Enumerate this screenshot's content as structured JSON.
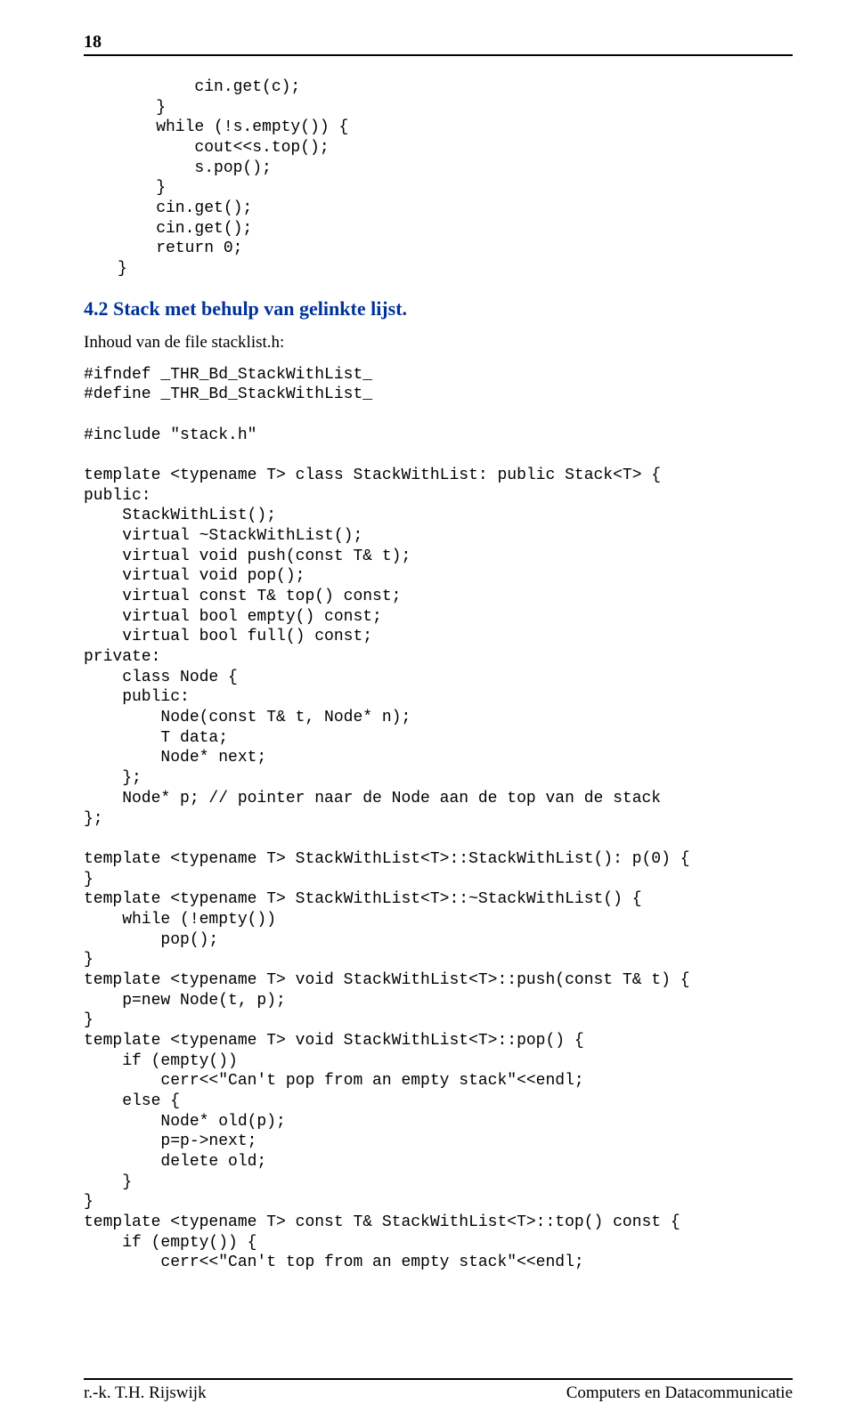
{
  "page_number": "18",
  "code_block_top": "        cin.get(c);\n    }\n    while (!s.empty()) {\n        cout<<s.top();\n        s.pop();\n    }\n    cin.get();\n    cin.get();\n    return 0;\n}",
  "section_heading": "4.2  Stack met behulp van gelinkte lijst.",
  "file_label": "Inhoud van de file stacklist.h:",
  "code_block_main": "#ifndef _THR_Bd_StackWithList_\n#define _THR_Bd_StackWithList_\n\n#include \"stack.h\"\n\ntemplate <typename T> class StackWithList: public Stack<T> {\npublic:\n    StackWithList();\n    virtual ~StackWithList();\n    virtual void push(const T& t);\n    virtual void pop();\n    virtual const T& top() const;\n    virtual bool empty() const;\n    virtual bool full() const;\nprivate:\n    class Node {\n    public:\n        Node(const T& t, Node* n);\n        T data;\n        Node* next;\n    };\n    Node* p; // pointer naar de Node aan de top van de stack\n};\n\ntemplate <typename T> StackWithList<T>::StackWithList(): p(0) {\n}\ntemplate <typename T> StackWithList<T>::~StackWithList() {\n    while (!empty())\n        pop();\n}\ntemplate <typename T> void StackWithList<T>::push(const T& t) {\n    p=new Node(t, p);\n}\ntemplate <typename T> void StackWithList<T>::pop() {\n    if (empty())\n        cerr<<\"Can't pop from an empty stack\"<<endl;\n    else {\n        Node* old(p);\n        p=p->next;\n        delete old;\n    }\n}\ntemplate <typename T> const T& StackWithList<T>::top() const {\n    if (empty()) {\n        cerr<<\"Can't top from an empty stack\"<<endl;",
  "footer_left": "r.-k. T.H. Rijswijk",
  "footer_right": "Computers en Datacommunicatie"
}
